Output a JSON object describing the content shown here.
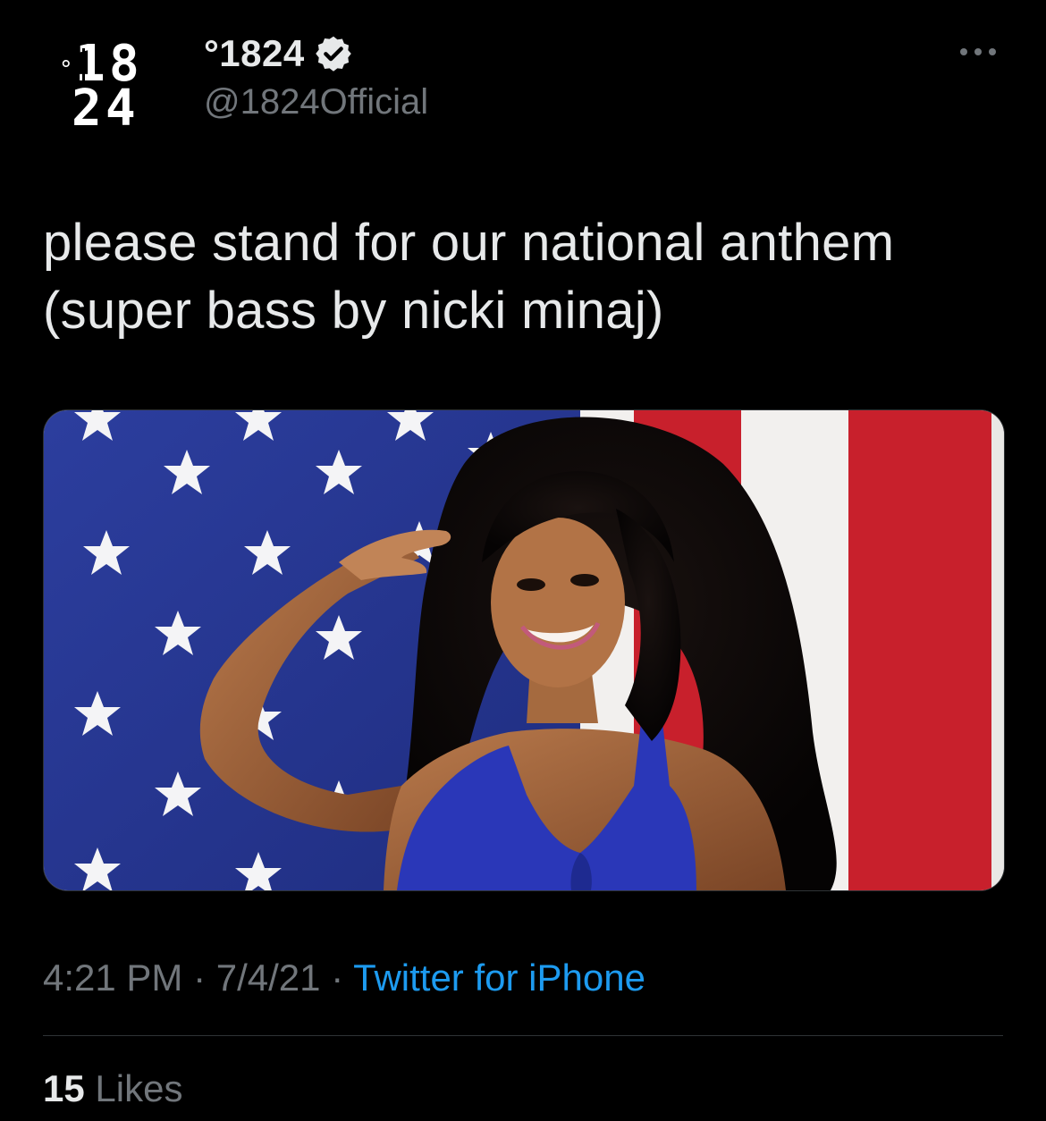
{
  "author": {
    "display_name": "°1824",
    "handle": "@1824Official",
    "verified": true,
    "avatar_text": "°18 24"
  },
  "icons": {
    "verified": "verified-badge-icon",
    "more": "more-options-icon"
  },
  "tweet": {
    "line1": "please stand for our national anthem",
    "line2": "(super bass by nicki minaj)"
  },
  "media": {
    "type": "photo"
  },
  "meta": {
    "time": "4:21 PM",
    "separator1": " · ",
    "date": "7/4/21",
    "separator2": " · ",
    "source": "Twitter for iPhone"
  },
  "stats": {
    "likes_count": "15",
    "likes_label": "Likes"
  },
  "colors": {
    "background": "#000000",
    "text_primary": "#e7e9ea",
    "text_secondary": "#71767b",
    "link": "#1d9bf0",
    "divider": "#2f3336"
  }
}
